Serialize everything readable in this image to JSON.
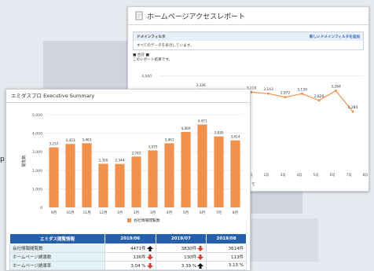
{
  "back_window": {
    "title": "ホームページアクセスレポート",
    "filter": {
      "header_left": "ドメインフィルタ",
      "header_right": "新しいドメインフィルタを追加",
      "body": "すべてのデータを表示しています。"
    },
    "section": {
      "heading": "■ 合計 ■",
      "note": "このレポート結果です。"
    },
    "tail_text": "て"
  },
  "front_window": {
    "title": "エミダスプロ Executive Summary"
  },
  "left_edge_text": "p",
  "chart_data": [
    {
      "type": "bar",
      "title": "",
      "ylabel": "閲覧数",
      "xlabel": "",
      "ylim": [
        0,
        5000
      ],
      "yticks": [
        "0",
        "1,000",
        "2,000",
        "3,000",
        "4,000",
        "5,000"
      ],
      "categories": [
        "9月",
        "10月",
        "11月",
        "12月",
        "1月",
        "2月",
        "3月",
        "4月",
        "5月",
        "6月",
        "7月",
        "8月"
      ],
      "series": [
        {
          "name": "会社情報閲覧数",
          "values": [
            3237,
            3423,
            3463,
            2350,
            2344,
            2742,
            3075,
            3461,
            4069,
            4471,
            3830,
            3614
          ]
        }
      ],
      "data_labels": [
        "3,237",
        "3,423",
        "3,463",
        "2,350",
        "2,344",
        "2,742",
        "3,075",
        "3,461",
        "4,069",
        "4,471",
        "3,830",
        "3,614"
      ],
      "legend_position": "bottom",
      "color": "#f0924e",
      "grid": true
    },
    {
      "type": "line",
      "title": "",
      "ylim": [
        0,
        4500
      ],
      "yticks": [
        "4,000"
      ],
      "categories": [
        "",
        "",
        "",
        "",
        "1月",
        "2月",
        "3月",
        "4月",
        "5月",
        "6月",
        "7月",
        "8月"
      ],
      "series": [
        {
          "name": "",
          "values": [
            null,
            null,
            null,
            3336,
            null,
            null,
            3210,
            3143,
            2972,
            3139,
            2820,
            3284,
            2284
          ]
        }
      ],
      "data_labels": [
        "3,336",
        "3,210",
        "3,143",
        "2,972",
        "3,139",
        "2,820",
        "3,284",
        "2,284"
      ],
      "color": "#f0924e",
      "grid": true
    }
  ],
  "table": {
    "header": [
      "エミダス閲覧情報",
      "2019/06",
      "2019/07",
      "2019/08"
    ],
    "rows": [
      {
        "label": "会社情報閲覧数",
        "cells": [
          "4471件",
          "3830件",
          "3614件"
        ],
        "arrows": [
          "up",
          "down",
          ""
        ]
      },
      {
        "label": "ホームページ誘導数",
        "cells": [
          "136件",
          "130件",
          "113件"
        ],
        "arrows": [
          "down",
          "down",
          ""
        ]
      },
      {
        "label": "ホームページ誘導率",
        "cells": [
          "3.04 %",
          "3.39 %",
          "3.13 %"
        ],
        "arrows": [
          "down",
          "up",
          ""
        ]
      }
    ]
  },
  "colors": {
    "accent": "#f0924e",
    "table_header": "#2460ad",
    "arrow_down": "#e03b2f",
    "arrow_up": "#111111"
  }
}
